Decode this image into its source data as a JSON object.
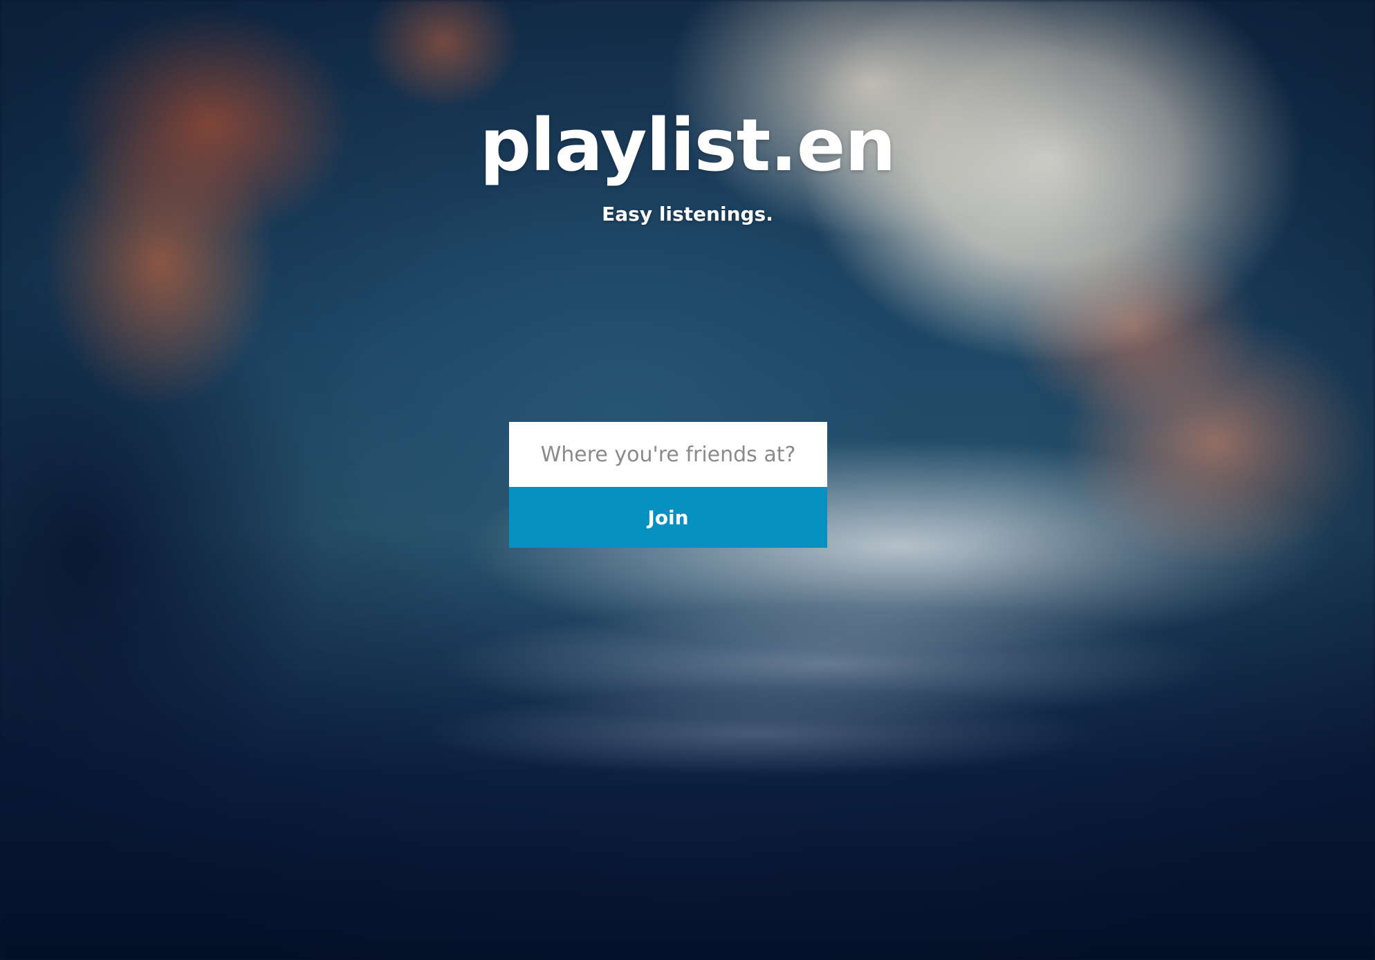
{
  "brand": {
    "logo_text": "playlist.en",
    "tagline": "Easy listenings."
  },
  "join_form": {
    "room_input": {
      "value": "",
      "placeholder": "Where you're friends at?"
    },
    "join_button_label": "Join"
  },
  "colors": {
    "accent": "#0590c0",
    "input_background": "#ffffff",
    "text_on_background": "#ffffff"
  }
}
